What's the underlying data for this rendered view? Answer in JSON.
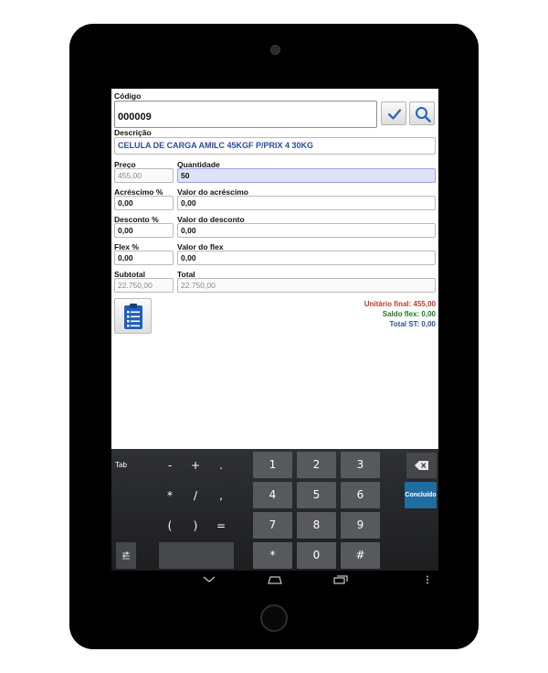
{
  "form": {
    "codigo": {
      "label": "Código",
      "value": "000009"
    },
    "descricao": {
      "label": "Descrição",
      "value": "CELULA DE CARGA AMILC 45KGF P/PRIX 4 30KG"
    },
    "preco": {
      "label": "Preço",
      "value": "455,00"
    },
    "quantidade": {
      "label": "Quantidade",
      "value": "50"
    },
    "acrescimo_pct": {
      "label": "Acréscimo %",
      "value": "0,00"
    },
    "valor_acrescimo": {
      "label": "Valor do acréscimo",
      "value": "0,00"
    },
    "desconto_pct": {
      "label": "Desconto %",
      "value": "0,00"
    },
    "valor_desconto": {
      "label": "Valor do desconto",
      "value": "0,00"
    },
    "flex_pct": {
      "label": "Flex %",
      "value": "0,00"
    },
    "valor_flex": {
      "label": "Valor do flex",
      "value": "0,00"
    },
    "subtotal": {
      "label": "Subtotal",
      "value": "22.750,00"
    },
    "total": {
      "label": "Total",
      "value": "22.750,00"
    }
  },
  "totals": {
    "unitario_final": "Unitário final: 455,00",
    "saldo_flex": "Saldo flex: 0,00",
    "total_st": "Total ST: 0,00"
  },
  "keyboard": {
    "tab": "Tab",
    "symbols": [
      "-",
      "+",
      ".",
      "*",
      "/",
      ",",
      "(",
      ")",
      "="
    ],
    "digits": [
      "1",
      "2",
      "3",
      "4",
      "5",
      "6",
      "7",
      "8",
      "9",
      "*",
      "0",
      "#"
    ],
    "done": "Concluído",
    "backspace_icon": "backspace-icon"
  },
  "colors": {
    "unitario_final": "#c0392b",
    "saldo_flex": "#1a7d1a",
    "total_st": "#2a4d9c",
    "accent": "#1f6da0",
    "highlight_field": "#dfe2fb"
  },
  "icons": {
    "confirm": "checkmark-icon",
    "search": "search-icon",
    "clipboard": "clipboard-list-icon",
    "nav_back": "back-icon",
    "nav_home": "home-icon",
    "nav_recents": "recents-icon",
    "overflow": "more-vertical-icon",
    "keyboard_settings": "keyboard-settings-icon"
  }
}
